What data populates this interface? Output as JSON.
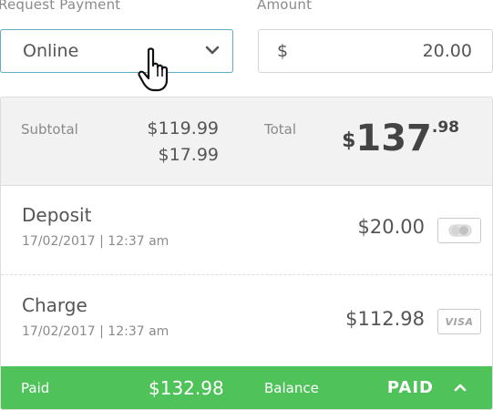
{
  "request_payment": {
    "label": "Request Payment",
    "selected": "Online",
    "chevron_icon": "chevron-down-icon"
  },
  "amount": {
    "label": "Amount",
    "currency": "$",
    "value": "20.00"
  },
  "summary": {
    "subtotal_label": "Subtotal",
    "subtotal_value": "$119.99",
    "extra_value": "$17.99",
    "total_label": "Total",
    "total_currency": "$",
    "total_main": "137",
    "total_cents": ".98"
  },
  "transactions": [
    {
      "title": "Deposit",
      "date": "17/02/2017 | 12:37 am",
      "amount": "$20.00",
      "method_icon": "toggle-card-icon"
    },
    {
      "title": "Charge",
      "date": "17/02/2017 | 12:37 am",
      "amount": "$112.98",
      "method_label": "VISA"
    }
  ],
  "footer": {
    "paid_label": "Paid",
    "paid_amount": "$132.98",
    "balance_label": "Balance",
    "status": "PAID",
    "chevron_icon": "chevron-up-icon"
  },
  "colors": {
    "accent_border": "#5eaec7",
    "footer_green": "#4fc35a"
  }
}
